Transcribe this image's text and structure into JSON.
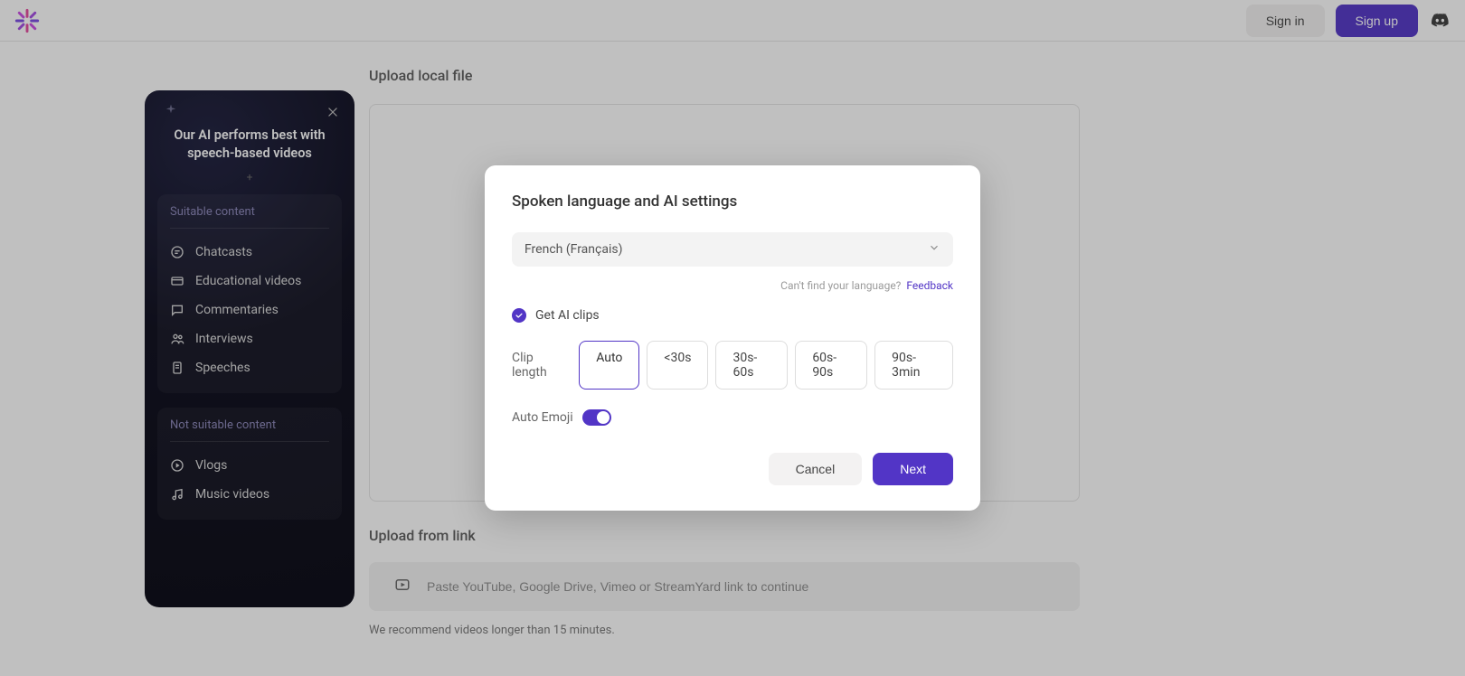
{
  "header": {
    "signin": "Sign in",
    "signup": "Sign up"
  },
  "main": {
    "upload_local_title": "Upload local file",
    "upload_from_link_title": "Upload from link",
    "link_placeholder": "Paste YouTube, Google Drive, Vimeo or StreamYard link to continue",
    "note": "We recommend videos longer than 15 minutes."
  },
  "sidebar": {
    "title": "Our AI performs best with speech-based videos",
    "suitable_title": "Suitable content",
    "suitable_items": [
      "Chatcasts",
      "Educational videos",
      "Commentaries",
      "Interviews",
      "Speeches"
    ],
    "not_suitable_title": "Not suitable content",
    "not_suitable_items": [
      "Vlogs",
      "Music videos"
    ]
  },
  "modal": {
    "title": "Spoken language and AI settings",
    "language": "French (Français)",
    "cant_find": "Can't find your language?",
    "feedback": "Feedback",
    "get_ai_clips": "Get AI clips",
    "clip_length_label": "Clip length",
    "clip_options": [
      "Auto",
      "<30s",
      "30s-60s",
      "60s-90s",
      "90s-3min"
    ],
    "clip_selected": "Auto",
    "auto_emoji_label": "Auto Emoji",
    "auto_emoji_on": true,
    "cancel": "Cancel",
    "next": "Next"
  }
}
